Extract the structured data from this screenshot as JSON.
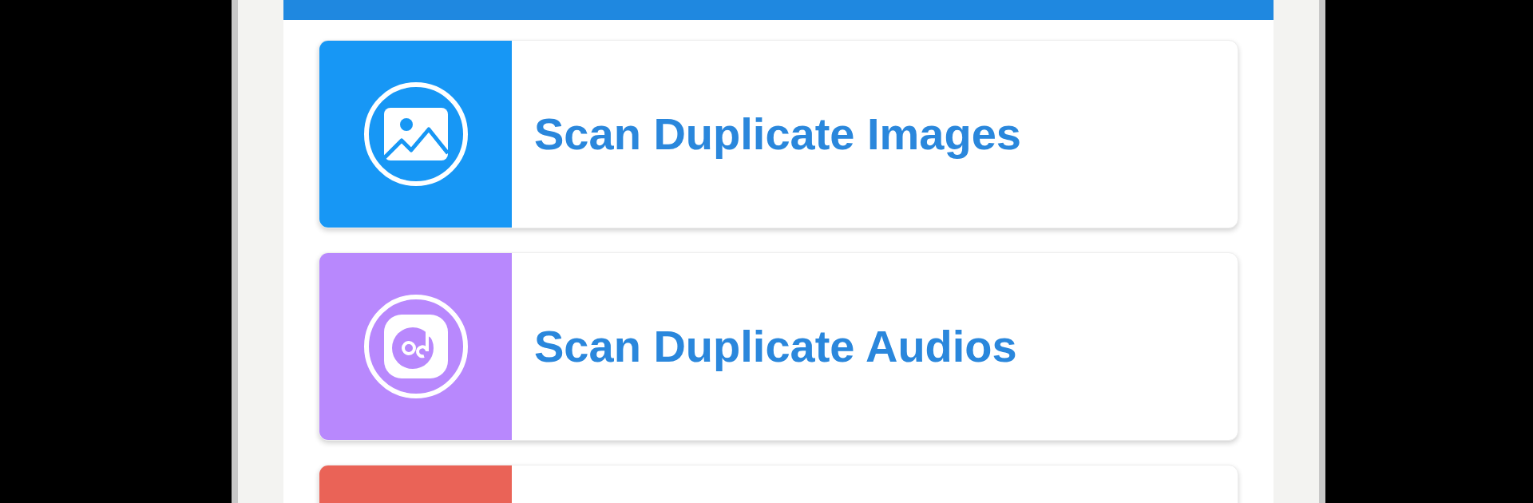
{
  "cards": [
    {
      "label": "Scan Duplicate Images",
      "color": "#1797f5"
    },
    {
      "label": "Scan Duplicate Audios",
      "color": "#b888fd"
    },
    {
      "color": "#ea6357"
    }
  ]
}
